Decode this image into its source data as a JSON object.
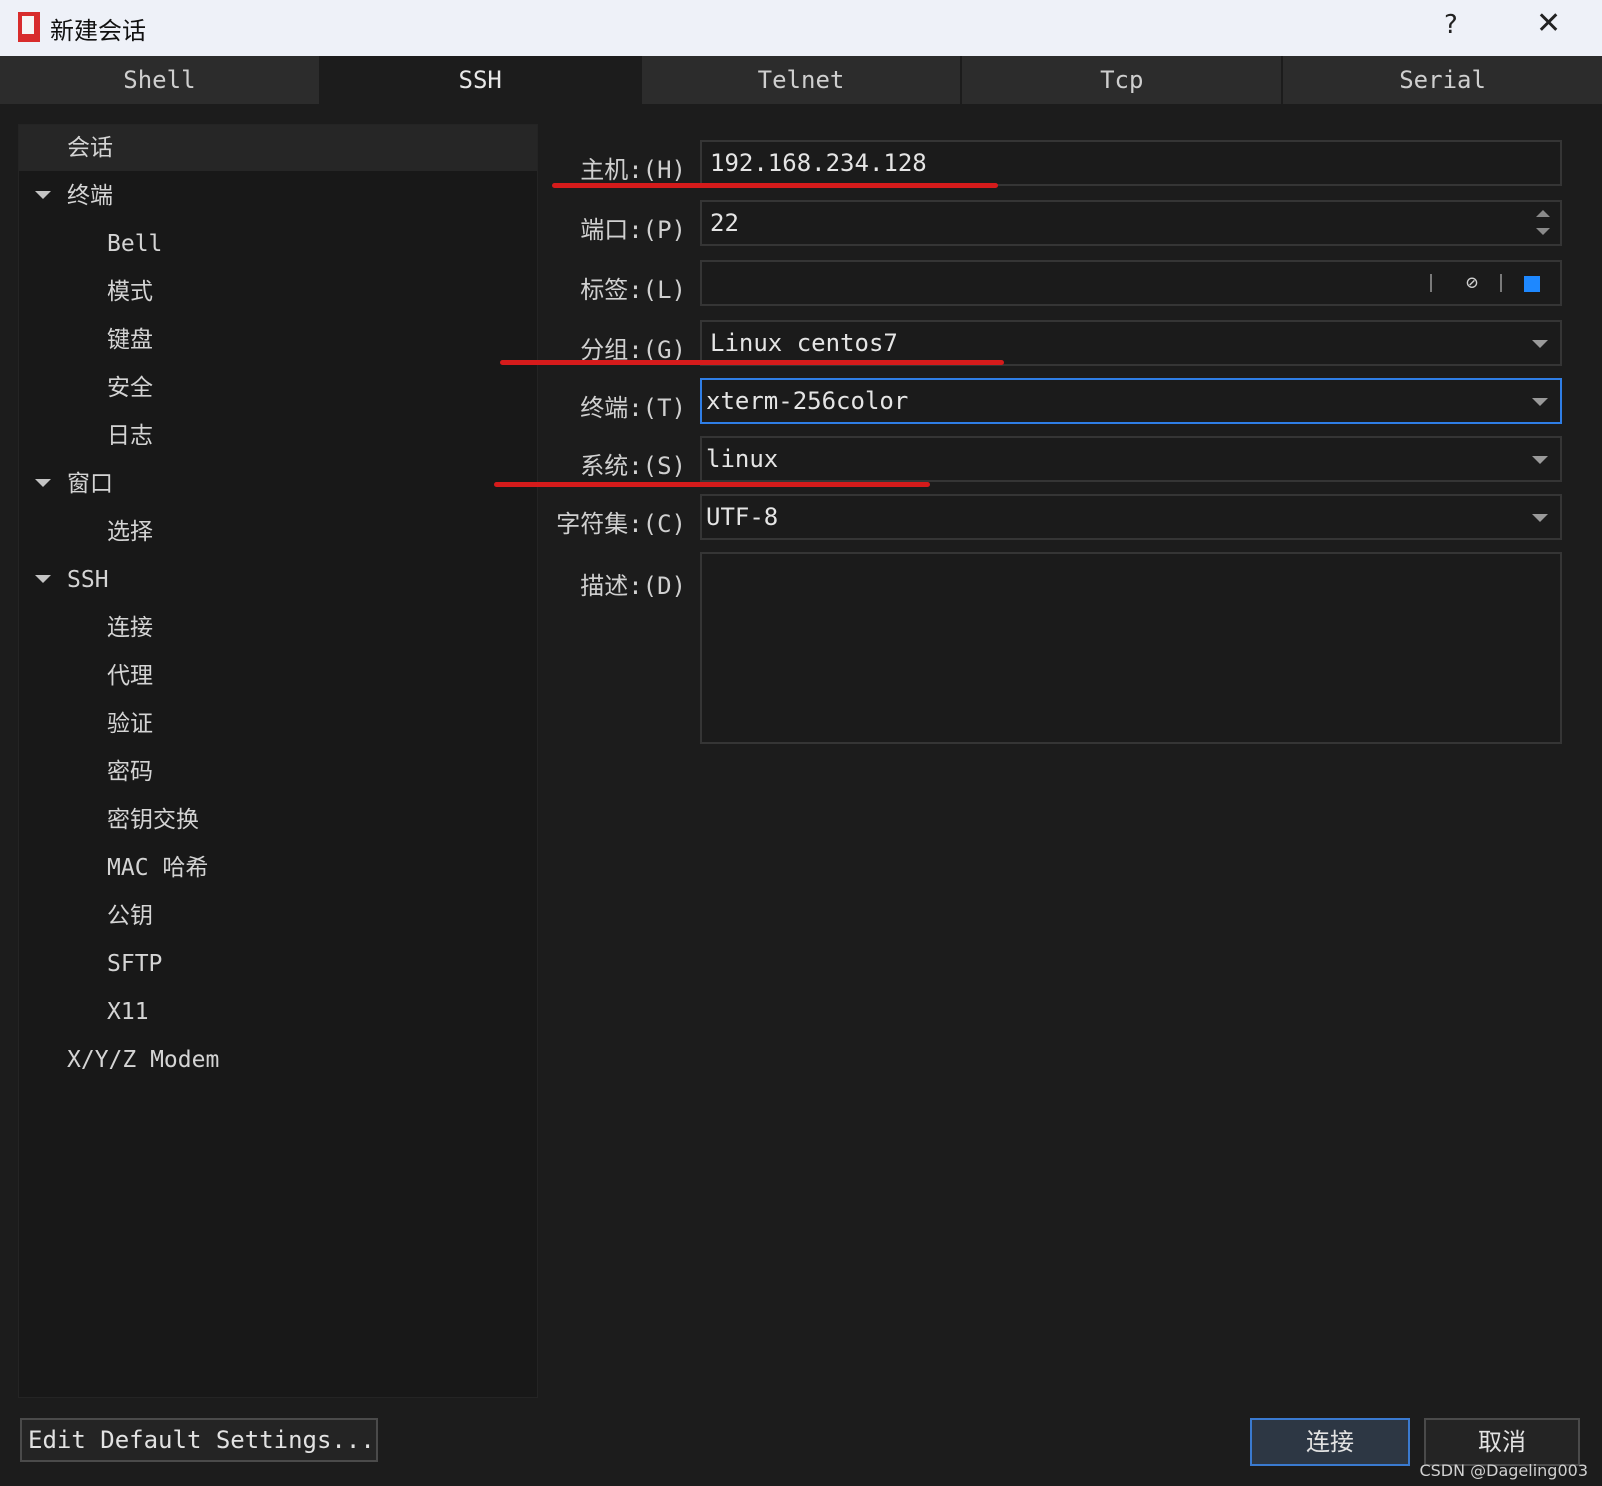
{
  "window": {
    "title": "新建会话",
    "help": "?",
    "close": "✕"
  },
  "tabs": [
    {
      "label": "Shell",
      "active": false
    },
    {
      "label": "SSH",
      "active": true
    },
    {
      "label": "Telnet",
      "active": false
    },
    {
      "label": "Tcp",
      "active": false
    },
    {
      "label": "Serial",
      "active": false
    }
  ],
  "tree": [
    {
      "label": "会话",
      "selected": true
    },
    {
      "label": "终端",
      "expanded": true
    },
    {
      "label": "Bell"
    },
    {
      "label": "模式"
    },
    {
      "label": "键盘"
    },
    {
      "label": "安全"
    },
    {
      "label": "日志"
    },
    {
      "label": "窗口",
      "expanded": true
    },
    {
      "label": "选择"
    },
    {
      "label": "SSH",
      "expanded": true
    },
    {
      "label": "连接"
    },
    {
      "label": "代理"
    },
    {
      "label": "验证"
    },
    {
      "label": "密码"
    },
    {
      "label": "密钥交换"
    },
    {
      "label": "MAC 哈希"
    },
    {
      "label": "公钥"
    },
    {
      "label": "SFTP"
    },
    {
      "label": "X11"
    },
    {
      "label": "X/Y/Z Modem"
    }
  ],
  "form": {
    "host": {
      "label": "主机:(H)",
      "value": "192.168.234.128"
    },
    "port": {
      "label": "端口:(P)",
      "value": "22"
    },
    "tag": {
      "label": "标签:(L)",
      "value": "",
      "color": "#1e88ff"
    },
    "group": {
      "label": "分组:(G)",
      "value": "Linux centos7"
    },
    "terminal": {
      "label": "终端:(T)",
      "value": "xterm-256color"
    },
    "system": {
      "label": "系统:(S)",
      "value": "linux"
    },
    "charset": {
      "label": "字符集:(C)",
      "value": "UTF-8"
    },
    "description": {
      "label": "描述:(D)",
      "value": ""
    }
  },
  "buttons": {
    "edit_default": "Edit Default Settings...",
    "connect": "连接",
    "cancel": "取消"
  },
  "watermark": "CSDN @Dageling003",
  "annotation_color": "#d51b1b"
}
